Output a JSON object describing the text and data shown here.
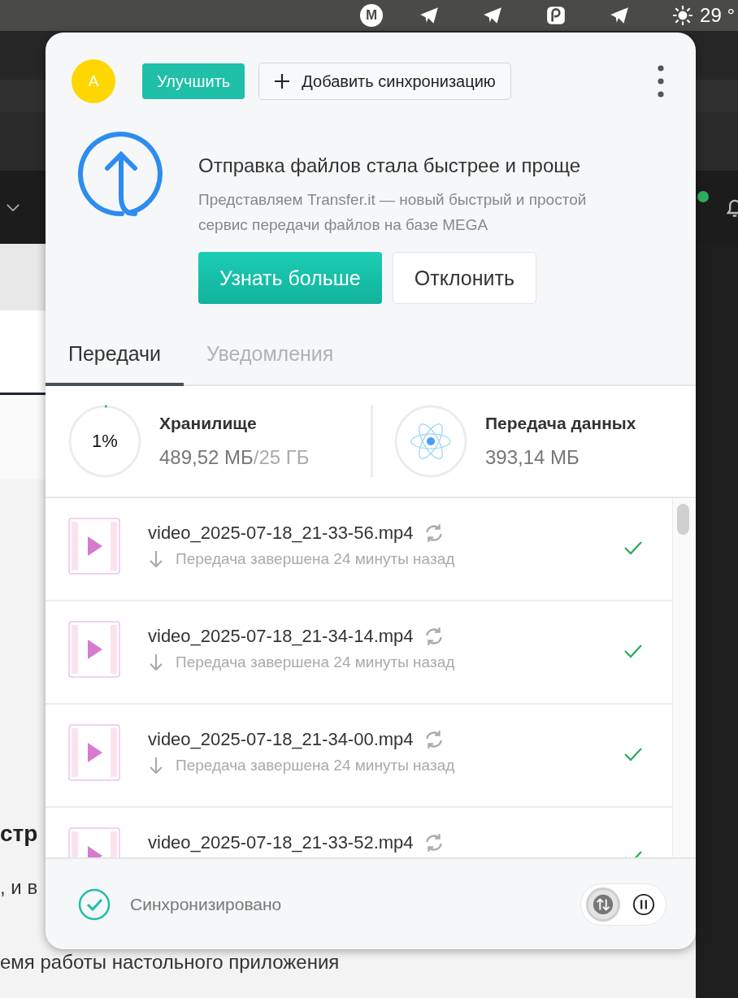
{
  "menubar": {
    "apps": [
      {
        "kind": "mega",
        "label": "M"
      },
      {
        "kind": "telegram"
      },
      {
        "kind": "telegram"
      },
      {
        "kind": "sync"
      },
      {
        "kind": "telegram"
      }
    ],
    "weather": "29 °"
  },
  "background": {
    "heading_fragment": "стр",
    "line_fragment": ", и в",
    "footer_line": "емя работы настольного приложения"
  },
  "header": {
    "avatar": "A",
    "upgrade_button": "Улучшить",
    "add_sync_button": "Добавить синхронизацию"
  },
  "promo": {
    "title": "Отправка файлов стала быстрее и проще",
    "description": "Представляем Transfer.it — новый быстрый и простой сервис передачи файлов на базе MEGA",
    "primary_button": "Узнать больше",
    "secondary_button": "Отклонить"
  },
  "tabs": [
    {
      "label": "Передачи",
      "selected": true
    },
    {
      "label": "Уведомления",
      "selected": false
    }
  ],
  "stats": {
    "storage": {
      "percent": "1%",
      "title": "Хранилище",
      "used": "489,52 МБ",
      "total": "/25 ГБ",
      "level": 0.01
    },
    "transfer": {
      "title": "Передача данных",
      "amount": "393,14 МБ"
    }
  },
  "transfers": [
    {
      "name": "video_2025-07-18_21-33-56.mp4",
      "status": "Передача завершена 24 минуты назад",
      "completed": true
    },
    {
      "name": "video_2025-07-18_21-34-14.mp4",
      "status": "Передача завершена 24 минуты назад",
      "completed": true
    },
    {
      "name": "video_2025-07-18_21-34-00.mp4",
      "status": "Передача завершена 24 минуты назад",
      "completed": true
    },
    {
      "name": "video_2025-07-18_21-33-52.mp4",
      "completed": true
    }
  ],
  "footer": {
    "status": "Синхронизировано",
    "controls": [
      {
        "kind": "transfers",
        "selected": true
      },
      {
        "kind": "pause",
        "selected": false
      }
    ]
  }
}
